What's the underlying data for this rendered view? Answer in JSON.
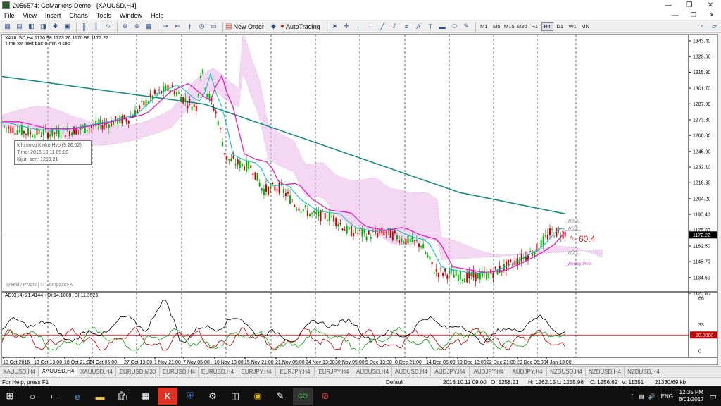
{
  "window": {
    "title": "2056574: GoMarkets-Demo - [XAUUSD,H4]",
    "minimize": "—",
    "restore": "❐",
    "close": "✕"
  },
  "menu": [
    "File",
    "View",
    "Insert",
    "Charts",
    "Tools",
    "Window",
    "Help"
  ],
  "toolbar": {
    "new_order": "New Order",
    "autotrading": "AutoTrading",
    "timeframes": [
      "M1",
      "M5",
      "M15",
      "M30",
      "H1",
      "H4",
      "D1",
      "W1",
      "MN"
    ],
    "active_tf": "H4"
  },
  "chart": {
    "symbol_line": "XAUUSD,H4  1170.98 1173.26 1170.98 1172.22",
    "timer_line": "Time for next bar: 0 min 4 sec",
    "current_price": "1172.22",
    "price_ticks": [
      "1343.40",
      "1329.60",
      "1315.80",
      "1301.70",
      "1287.90",
      "1273.80",
      "1260.00",
      "1245.90",
      "1232.10",
      "1218.30",
      "1204.20",
      "1190.40",
      "1176.30",
      "1162.50",
      "1148.70",
      "1134.60",
      "1120.80"
    ],
    "time_ticks": [
      "10 Oct 2016",
      "13 Oct 13:00",
      "18 Oct 21:00",
      "24 Oct 05:00",
      "27 Oct 13:00",
      "1 Nov 21:00",
      "7 Nov 05:00",
      "10 Nov 13:00",
      "15 Nov 21:00",
      "21 Nov 05:00",
      "24 Nov 13:00",
      "30 Nov 05:00",
      "5 Dec 13:00",
      "8 Dec 21:00",
      "14 Dec 05:00",
      "19 Dec 13:00",
      "22 Dec 21:00",
      "29 Dec 05:00",
      "4 Jan 13:00"
    ],
    "tooltip": {
      "line1": "Ichimoku Kinko Hyo (9,26,52)",
      "line2": "Time: 2016.10.11 09:00",
      "line3": "Kijun-sen: 1259.21"
    },
    "annotation": "^- 60:4",
    "pivot_labels": [
      "WR 3",
      "WR 2",
      "WR 1",
      "Weekly Pivot"
    ],
    "weekly_pivots_credit": "Weekly Pivots | © CompassFX",
    "adx_info": "ADX(14) 21.4144 +DI:14.1008 -DI:11.3525",
    "adx_ticks": [
      "66",
      "33",
      "20.0000",
      "0"
    ],
    "colors": {
      "bull": "#00b000",
      "bear": "#cc0000",
      "cloud": "#c040c0",
      "kijun": "#e020c0",
      "tenkan": "#00c0c0",
      "ma": "#1a8a8a",
      "annotation": "#e02020",
      "adx": "#000000",
      "plus_di": "#00a000",
      "minus_di": "#c00000",
      "adx_level": "#c00000"
    }
  },
  "tabs": [
    "XAUUSD,H4",
    "XAUUSD,H4",
    "XAUUSD,H4",
    "EURUSD,M30",
    "EURUSD,H4",
    "EURUSD,H4",
    "EURJPY,H4",
    "EURJPY,H4",
    "EURJPY,H4",
    "AUDUSD,H4",
    "AUDUSD,H4",
    "AUDJPY,H4",
    "AUDJPY,H4",
    "AUDJPY,H4",
    "NZDUSD,H4",
    "NZDUSD,H4",
    "NZDUSD,H4"
  ],
  "active_tab": 1,
  "status": {
    "help": "For Help, press F1",
    "profile": "Default",
    "time": "2016.10.11 09:00",
    "open": "O: 1258.21",
    "high": "H: 1262.15",
    "low": "L: 1255.96",
    "close": "C: 1256.62",
    "volume": "V: 11351",
    "traffic": "21330/69 kb"
  },
  "taskbar": {
    "lang": "ENG",
    "time": "12:35 PM",
    "date": "8/01/2017"
  }
}
